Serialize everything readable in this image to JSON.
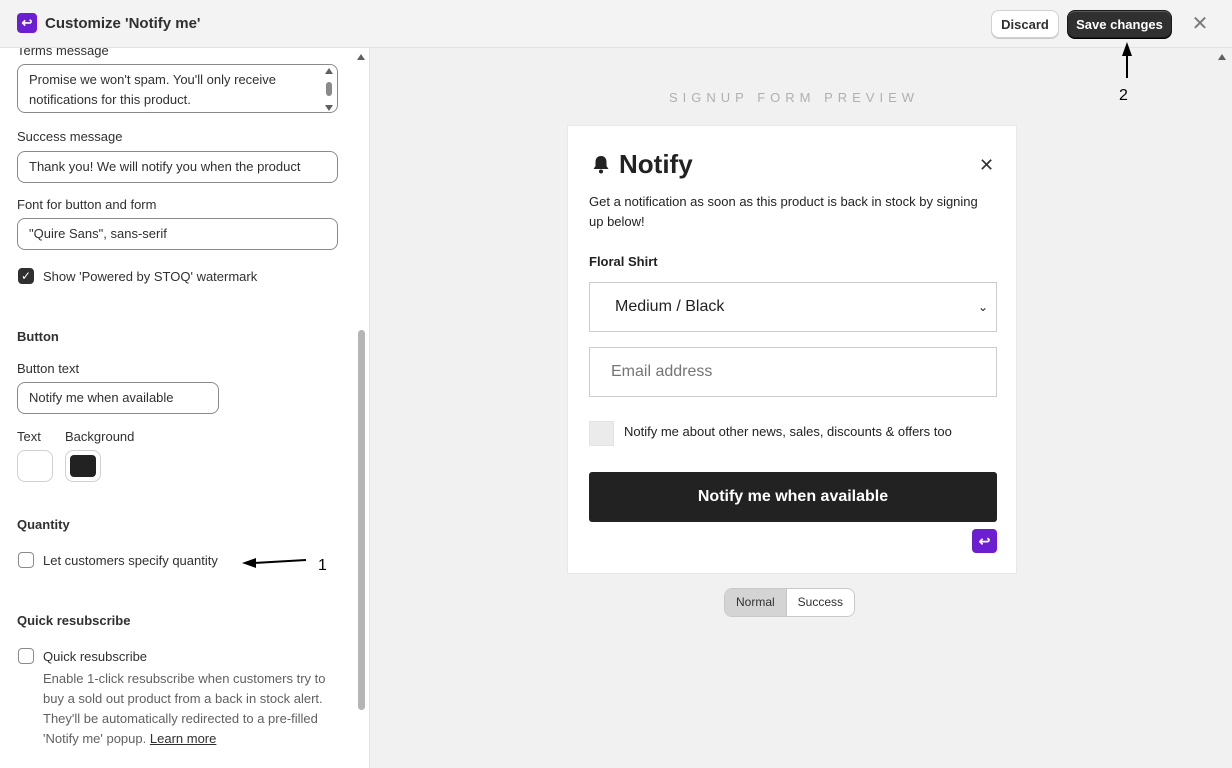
{
  "header": {
    "app_logo_icon": "curved-arrow-icon",
    "title": "Customize 'Notify me'",
    "discard_label": "Discard",
    "save_label": "Save changes",
    "close_glyph": "✕"
  },
  "sidebar": {
    "terms_label": "Terms message",
    "terms_value": "Promise we won't spam. You'll only receive notifications for this product.",
    "success_label": "Success message",
    "success_value": "Thank you! We will notify you when the product",
    "font_label": "Font for button and form",
    "font_value": "\"Quire Sans\", sans-serif",
    "watermark_label": "Show 'Powered by STOQ' watermark",
    "watermark_checked": true,
    "button_section": "Button",
    "button_text_label": "Button text",
    "button_text_value": "Notify me when available",
    "text_color_label": "Text",
    "background_color_label": "Background",
    "text_color": "#ffffff",
    "background_color": "#222222",
    "quantity_section": "Quantity",
    "quantity_label": "Let customers specify quantity",
    "quantity_checked": false,
    "resub_section": "Quick resubscribe",
    "resub_label": "Quick resubscribe",
    "resub_checked": false,
    "resub_help": "Enable 1-click resubscribe when customers try to buy a sold out product from a back in stock alert. They'll be automatically redirected to a pre-filled 'Notify me' popup.",
    "learn_more": "Learn more"
  },
  "preview": {
    "heading": "SIGNUP FORM PREVIEW",
    "form_title": "Notify",
    "close_glyph": "✕",
    "description": "Get a notification as soon as this product is back in stock by signing up below!",
    "product_name": "Floral Shirt",
    "variant_selected": "Medium / Black",
    "email_placeholder": "Email address",
    "marketing_label": "Notify me about other news, sales, discounts & offers too",
    "button_label": "Notify me when available",
    "tabs": [
      {
        "label": "Normal",
        "active": true
      },
      {
        "label": "Success",
        "active": false
      }
    ]
  },
  "annotations": {
    "label_1": "1",
    "label_2": "2"
  },
  "colors": {
    "brand_purple": "#6b1fd1",
    "primary_dark": "#303030",
    "form_button": "#222222"
  }
}
